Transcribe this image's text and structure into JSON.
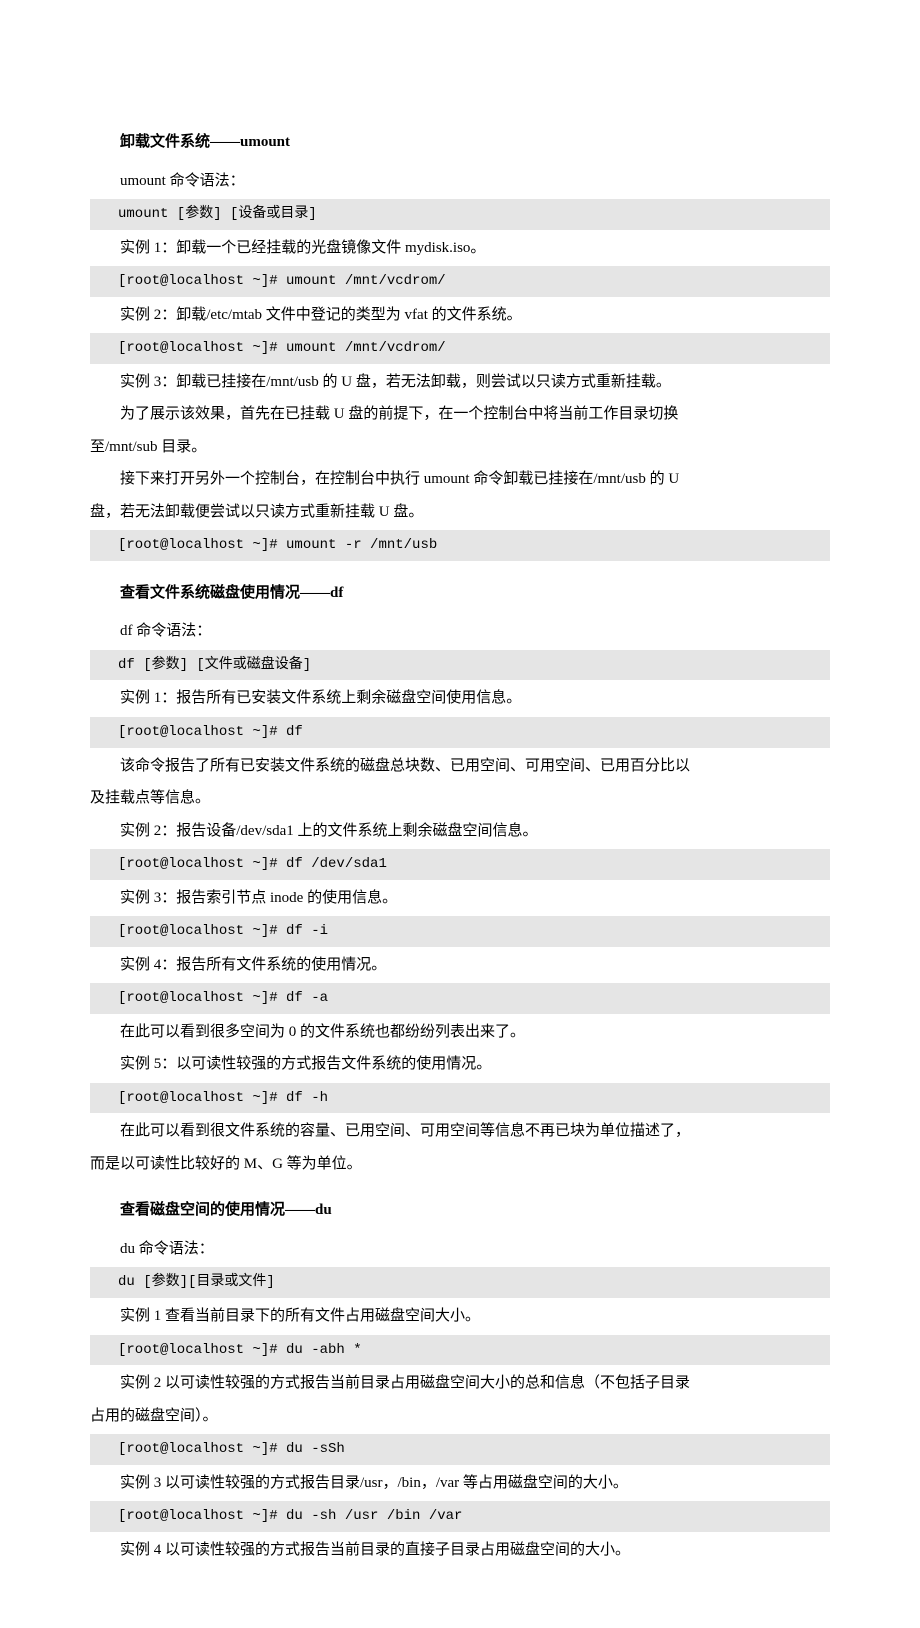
{
  "s1": {
    "title": "卸载文件系统——umount",
    "p1": "umount 命令语法：",
    "c1": "umount [参数] [设备或目录]",
    "p2": "实例 1：卸载一个已经挂载的光盘镜像文件 mydisk.iso。",
    "c2": "[root@localhost ~]# umount /mnt/vcdrom/",
    "p3": "实例 2：卸载/etc/mtab 文件中登记的类型为 vfat 的文件系统。",
    "c3": "[root@localhost ~]# umount /mnt/vcdrom/",
    "p4": "实例 3：卸载已挂接在/mnt/usb 的 U 盘，若无法卸载，则尝试以只读方式重新挂载。",
    "p5": "为了展示该效果，首先在已挂载 U 盘的前提下，在一个控制台中将当前工作目录切换至/mnt/sub 目录。",
    "p5b": "至/mnt/sub 目录。",
    "p6": "接下来打开另外一个控制台，在控制台中执行 umount 命令卸载已挂接在/mnt/usb 的 U 盘，若无法卸载便尝试以只读方式重新挂载 U 盘。",
    "p6b": "盘，若无法卸载便尝试以只读方式重新挂载 U 盘。",
    "c4": "[root@localhost ~]# umount -r /mnt/usb"
  },
  "s2": {
    "title": "查看文件系统磁盘使用情况——df",
    "p1": "df 命令语法：",
    "c1": "df [参数] [文件或磁盘设备]",
    "p2": "实例 1：报告所有已安装文件系统上剩余磁盘空间使用信息。",
    "c2": "[root@localhost ~]# df",
    "p3": "该命令报告了所有已安装文件系统的磁盘总块数、已用空间、可用空间、已用百分比以及挂载点等信息。",
    "p3b": "及挂载点等信息。",
    "p4": "实例 2：报告设备/dev/sda1 上的文件系统上剩余磁盘空间信息。",
    "c3": "[root@localhost ~]# df /dev/sda1",
    "p5": "实例 3：报告索引节点 inode 的使用信息。",
    "c4": "[root@localhost ~]# df -i",
    "p6": "实例 4：报告所有文件系统的使用情况。",
    "c5": "[root@localhost ~]# df -a",
    "p7": "在此可以看到很多空间为 0 的文件系统也都纷纷列表出来了。",
    "p8": "实例 5：以可读性较强的方式报告文件系统的使用情况。",
    "c6": "[root@localhost ~]# df -h",
    "p9": "在此可以看到很文件系统的容量、已用空间、可用空间等信息不再已块为单位描述了，而是以可读性比较好的 M、G 等为单位。",
    "p9b": "而是以可读性比较好的 M、G 等为单位。"
  },
  "s3": {
    "title": "查看磁盘空间的使用情况——du",
    "p1": "du 命令语法：",
    "c1": "du [参数][目录或文件]",
    "p2": "实例 1 查看当前目录下的所有文件占用磁盘空间大小。",
    "c2": "[root@localhost ~]# du -abh *",
    "p3": "实例 2 以可读性较强的方式报告当前目录占用磁盘空间大小的总和信息（不包括子目录占用的磁盘空间）。",
    "p3b": "占用的磁盘空间）。",
    "c3": "[root@localhost ~]# du -sSh",
    "p4": "实例 3 以可读性较强的方式报告目录/usr，/bin，/var 等占用磁盘空间的大小。",
    "c4": "[root@localhost ~]# du -sh /usr /bin /var",
    "p5": "实例 4 以可读性较强的方式报告当前目录的直接子目录占用磁盘空间的大小。"
  }
}
